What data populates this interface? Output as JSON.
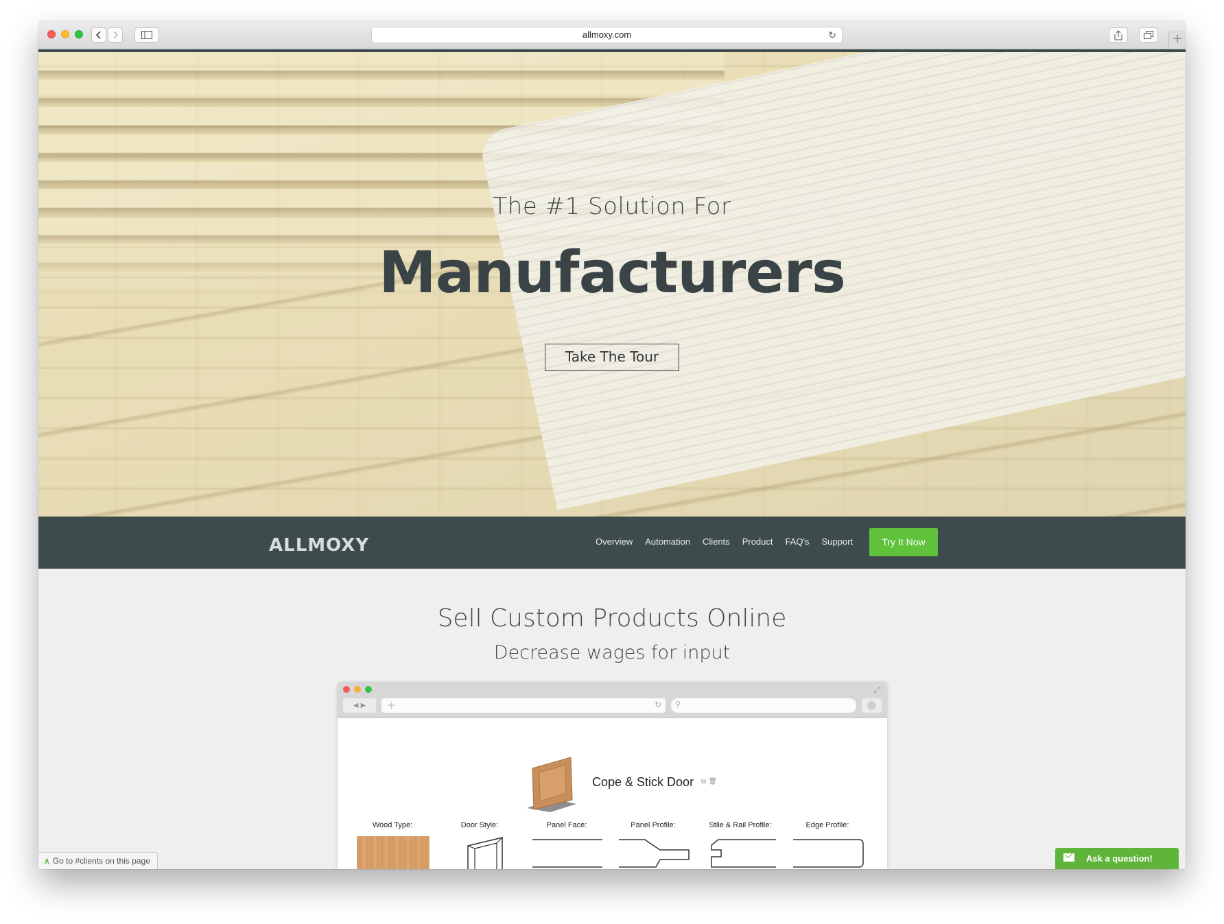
{
  "browser": {
    "url": "allmoxy.com"
  },
  "hero": {
    "tagline": "The #1 Solution For",
    "headline": "Manufacturers",
    "cta_label": "Take The Tour"
  },
  "nav": {
    "logo_text": "ALLMOXY",
    "links": [
      "Overview",
      "Automation",
      "Clients",
      "Product",
      "FAQ's",
      "Support"
    ],
    "cta_label": "Try It Now"
  },
  "section": {
    "title": "Sell Custom Products Online",
    "subtitle": "Decrease wages for input"
  },
  "mockup": {
    "product_title": "Cope & Stick Door",
    "options": [
      "Wood Type:",
      "Door Style:",
      "Panel Face:",
      "Panel Profile:",
      "Stile & Rail Profile:",
      "Edge Profile:"
    ]
  },
  "status_bar": {
    "link_hint": "Go to #clients on this page"
  },
  "chat": {
    "label": "Ask a question!"
  },
  "colors": {
    "nav_bg": "#3e4b4c",
    "accent_green": "#60c23a",
    "page_bg": "#efefef"
  }
}
